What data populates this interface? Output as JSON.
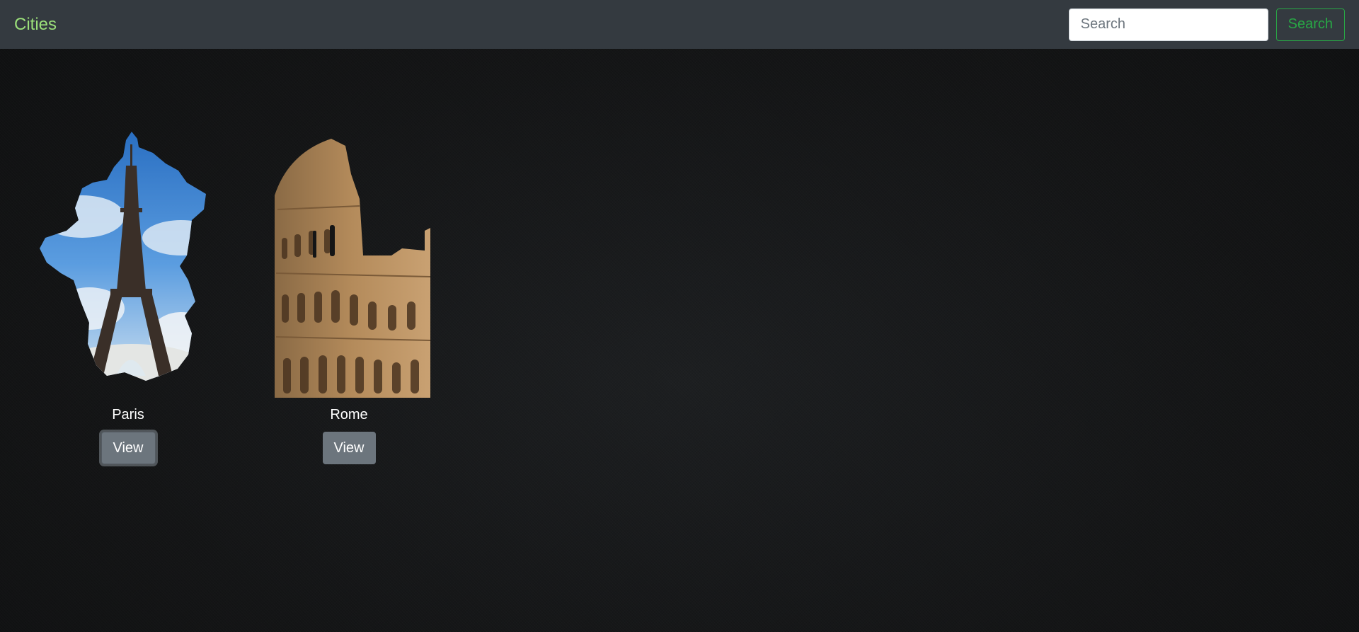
{
  "navbar": {
    "brand": "Cities",
    "search_placeholder": "Search",
    "search_button": "Search"
  },
  "cities": [
    {
      "name": "Paris",
      "view_label": "View"
    },
    {
      "name": "Rome",
      "view_label": "View"
    }
  ],
  "colors": {
    "navbar_bg": "#343a40",
    "brand": "#9be07a",
    "search_button": "#28a745",
    "view_button": "#6c757d"
  }
}
